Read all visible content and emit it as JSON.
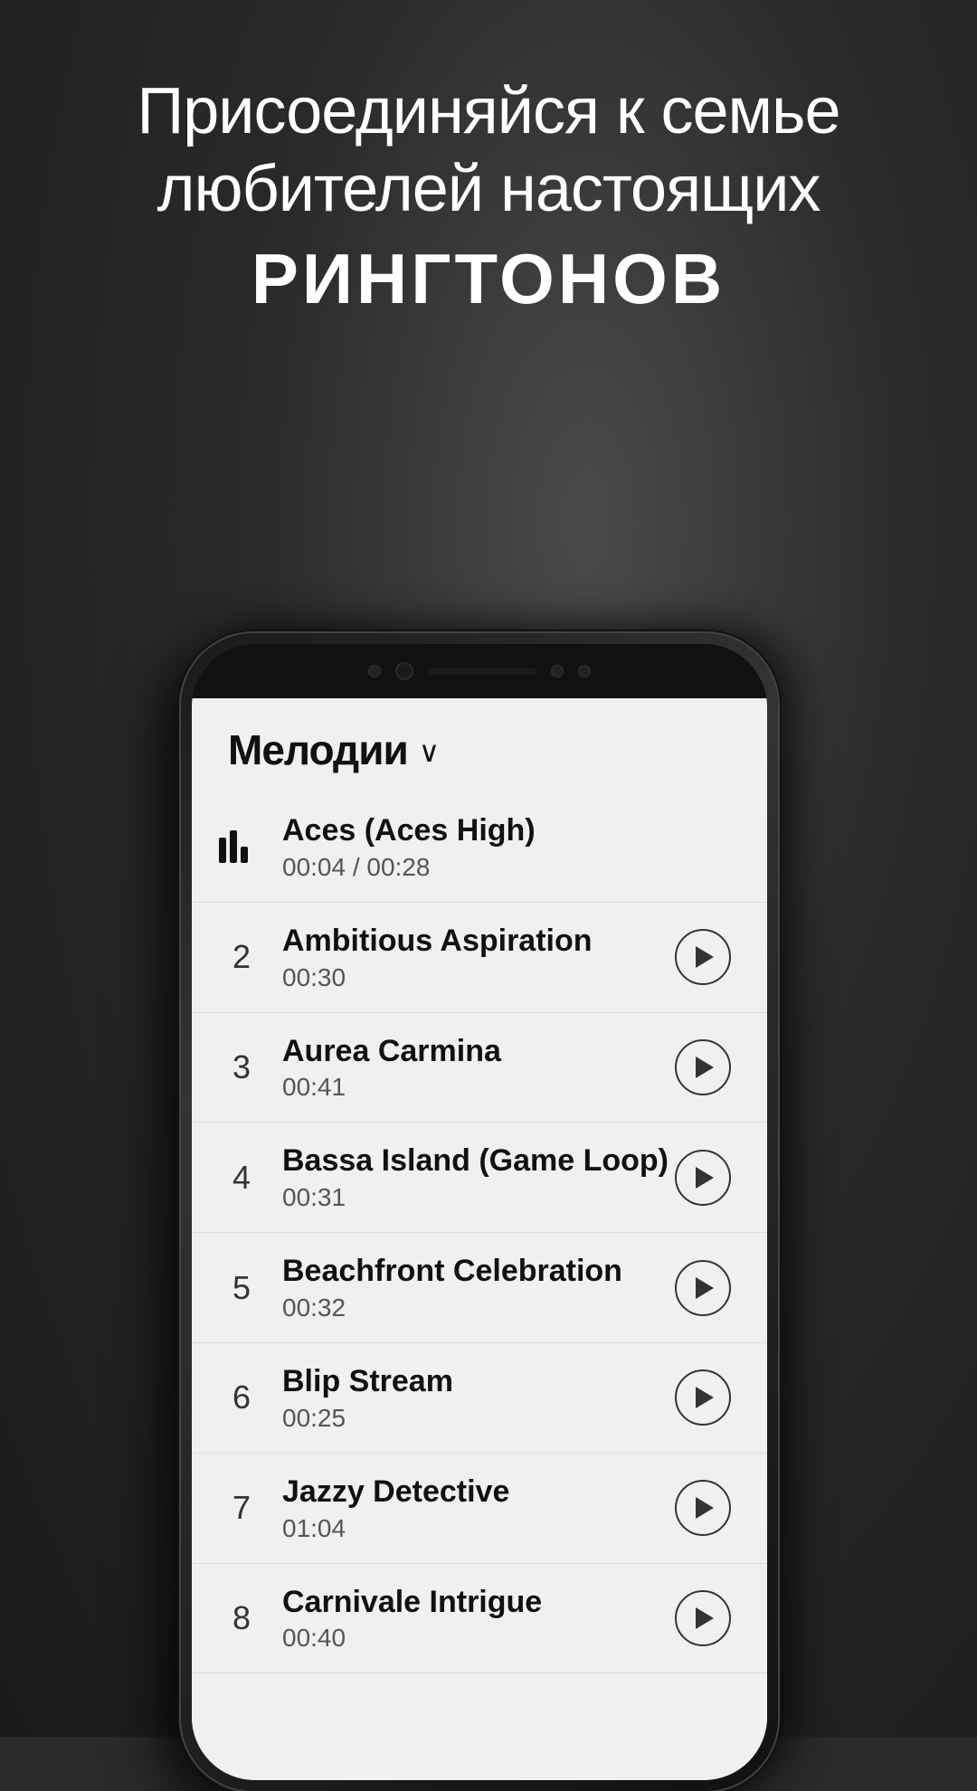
{
  "background": {
    "color": "#2a2a2a"
  },
  "headline": {
    "line1": "Присоединяйся к семье",
    "line2": "любителей настоящих",
    "line3": "РИНГТОНОВ"
  },
  "app": {
    "title": "Мелодии",
    "chevron": "∨",
    "tracks": [
      {
        "number": "",
        "name": "Aces (Aces High)",
        "duration": "00:04 / 00:28",
        "playing": true,
        "has_play_btn": false
      },
      {
        "number": "2",
        "name": "Ambitious Aspiration",
        "duration": "00:30",
        "playing": false,
        "has_play_btn": true
      },
      {
        "number": "3",
        "name": "Aurea Carmina",
        "duration": "00:41",
        "playing": false,
        "has_play_btn": true
      },
      {
        "number": "4",
        "name": "Bassa Island (Game Loop)",
        "duration": "00:31",
        "playing": false,
        "has_play_btn": true
      },
      {
        "number": "5",
        "name": "Beachfront Celebration",
        "duration": "00:32",
        "playing": false,
        "has_play_btn": true
      },
      {
        "number": "6",
        "name": "Blip Stream",
        "duration": "00:25",
        "playing": false,
        "has_play_btn": true
      },
      {
        "number": "7",
        "name": "Jazzy Detective",
        "duration": "01:04",
        "playing": false,
        "has_play_btn": true
      },
      {
        "number": "8",
        "name": "Carnivale Intrigue",
        "duration": "00:40",
        "playing": false,
        "has_play_btn": true
      }
    ]
  }
}
